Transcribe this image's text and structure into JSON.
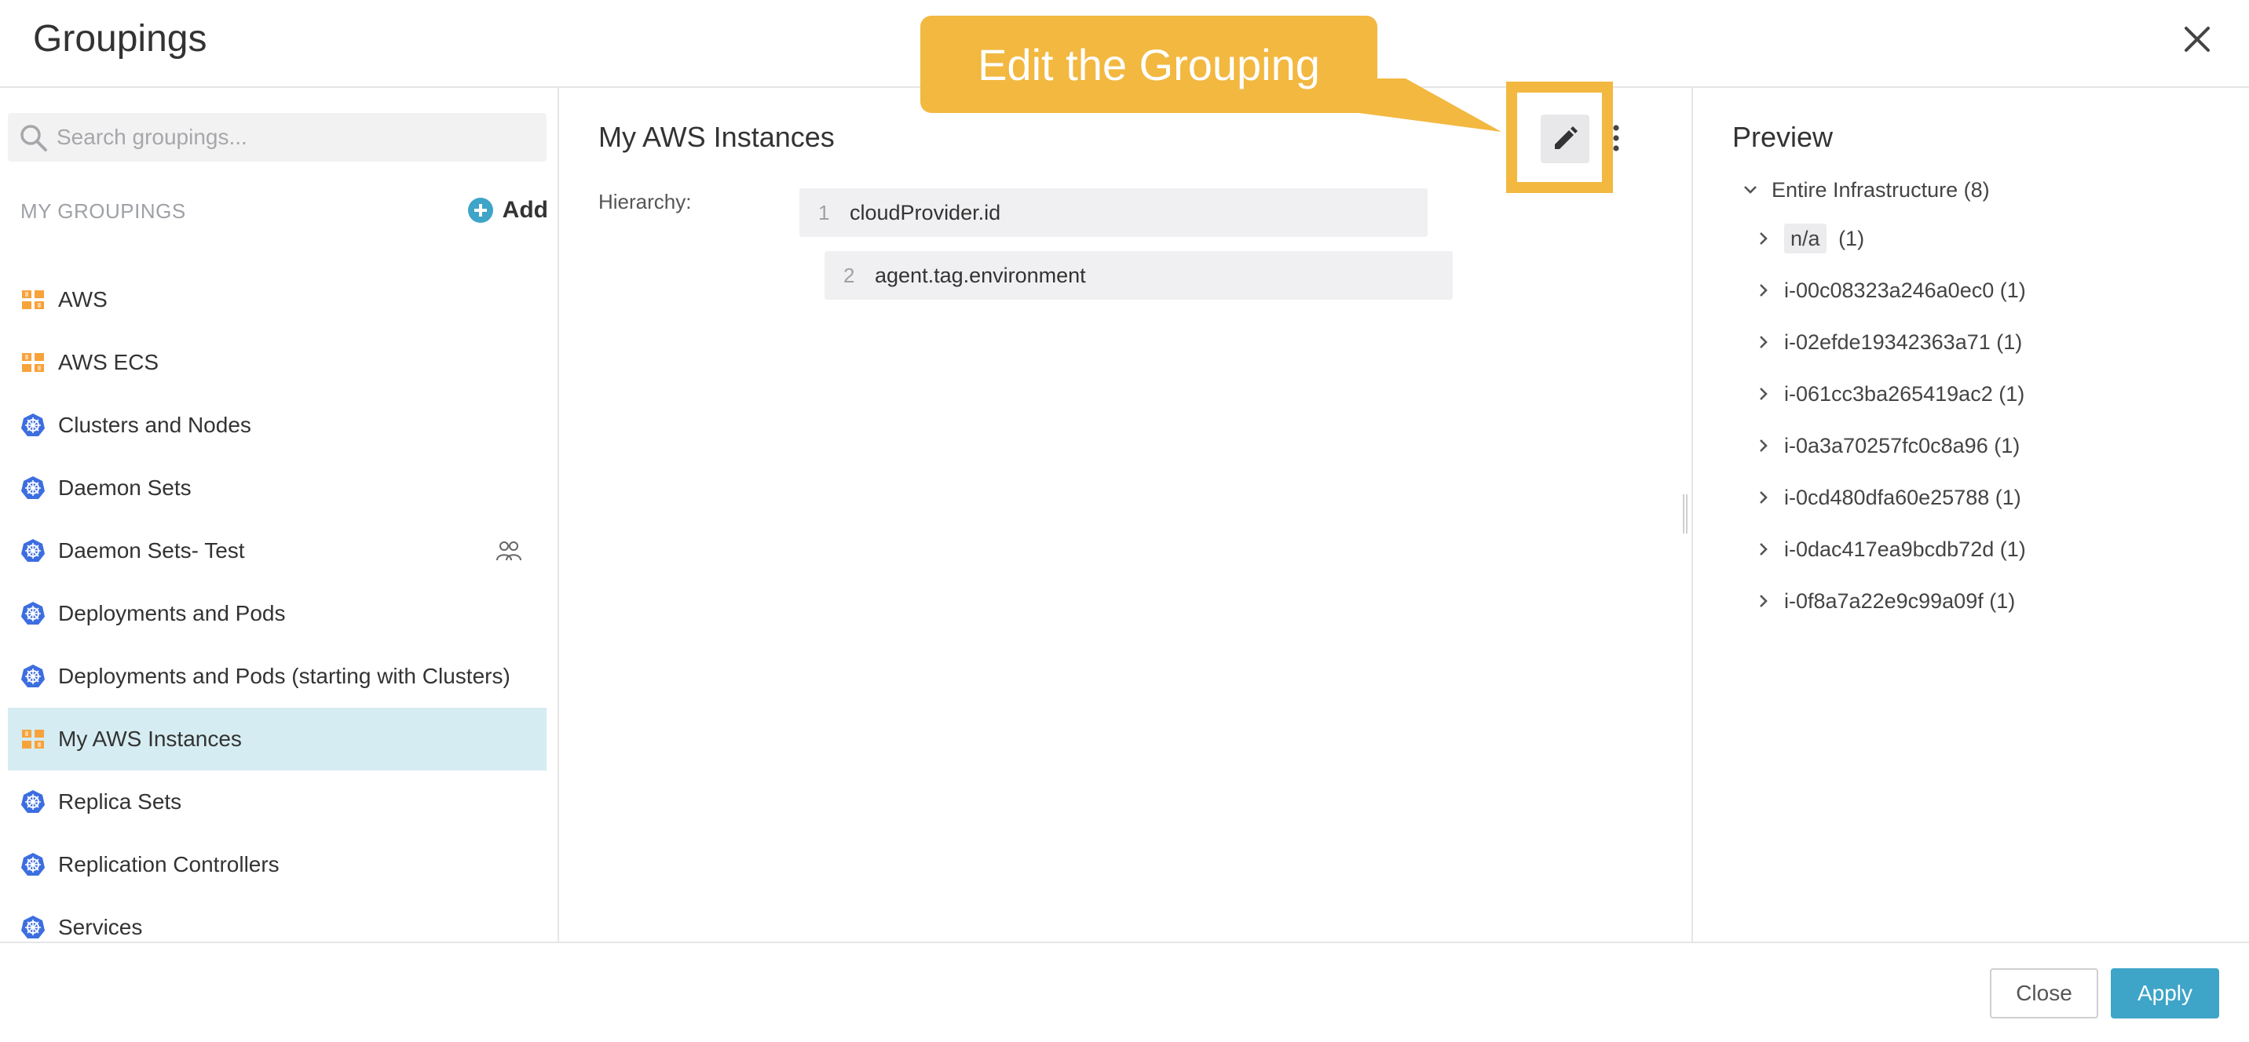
{
  "dialog": {
    "title": "Groupings",
    "close_icon": "close-icon"
  },
  "sidebar": {
    "search_placeholder": "Search groupings...",
    "section_label": "MY GROUPINGS",
    "add_label": "Add",
    "items": [
      {
        "label": "AWS",
        "icon": "aws-icon",
        "icon_color": "#f7a23b"
      },
      {
        "label": "AWS ECS",
        "icon": "aws-icon",
        "icon_color": "#f7a23b"
      },
      {
        "label": "Clusters and Nodes",
        "icon": "kubernetes-icon",
        "icon_color": "#3d6ee0"
      },
      {
        "label": "Daemon Sets",
        "icon": "kubernetes-icon",
        "icon_color": "#3d6ee0"
      },
      {
        "label": "Daemon Sets- Test",
        "icon": "kubernetes-icon",
        "icon_color": "#3d6ee0",
        "shared": true
      },
      {
        "label": "Deployments and Pods",
        "icon": "kubernetes-icon",
        "icon_color": "#3d6ee0"
      },
      {
        "label": "Deployments and Pods (starting with Clusters)",
        "icon": "kubernetes-icon",
        "icon_color": "#3d6ee0"
      },
      {
        "label": "My AWS Instances",
        "icon": "aws-icon",
        "icon_color": "#f7a23b",
        "selected": true
      },
      {
        "label": "Replica Sets",
        "icon": "kubernetes-icon",
        "icon_color": "#3d6ee0"
      },
      {
        "label": "Replication Controllers",
        "icon": "kubernetes-icon",
        "icon_color": "#3d6ee0"
      },
      {
        "label": "Services",
        "icon": "kubernetes-icon",
        "icon_color": "#3d6ee0"
      }
    ]
  },
  "main": {
    "grouping_title": "My AWS Instances",
    "hierarchy_label": "Hierarchy:",
    "hierarchy": [
      {
        "num": "1",
        "value": "cloudProvider.id"
      },
      {
        "num": "2",
        "value": "agent.tag.environment"
      }
    ],
    "edit_icon": "pencil-icon",
    "more_icon": "kebab-menu-icon"
  },
  "callout": {
    "text": "Edit the Grouping",
    "color": "#f2b840"
  },
  "preview": {
    "title": "Preview",
    "root": {
      "label": "Entire Infrastructure",
      "count": "(8)"
    },
    "children": [
      {
        "label": "n/a",
        "count": "(1)",
        "tag": true
      },
      {
        "label": "i-00c08323a246a0ec0",
        "count": "(1)"
      },
      {
        "label": "i-02efde19342363a71",
        "count": "(1)"
      },
      {
        "label": "i-061cc3ba265419ac2",
        "count": "(1)"
      },
      {
        "label": "i-0a3a70257fc0c8a96",
        "count": "(1)"
      },
      {
        "label": "i-0cd480dfa60e25788",
        "count": "(1)"
      },
      {
        "label": "i-0dac417ea9bcdb72d",
        "count": "(1)"
      },
      {
        "label": "i-0f8a7a22e9c99a09f",
        "count": "(1)"
      }
    ]
  },
  "footer": {
    "close_label": "Close",
    "apply_label": "Apply",
    "accent_color": "#3ea4c8"
  }
}
